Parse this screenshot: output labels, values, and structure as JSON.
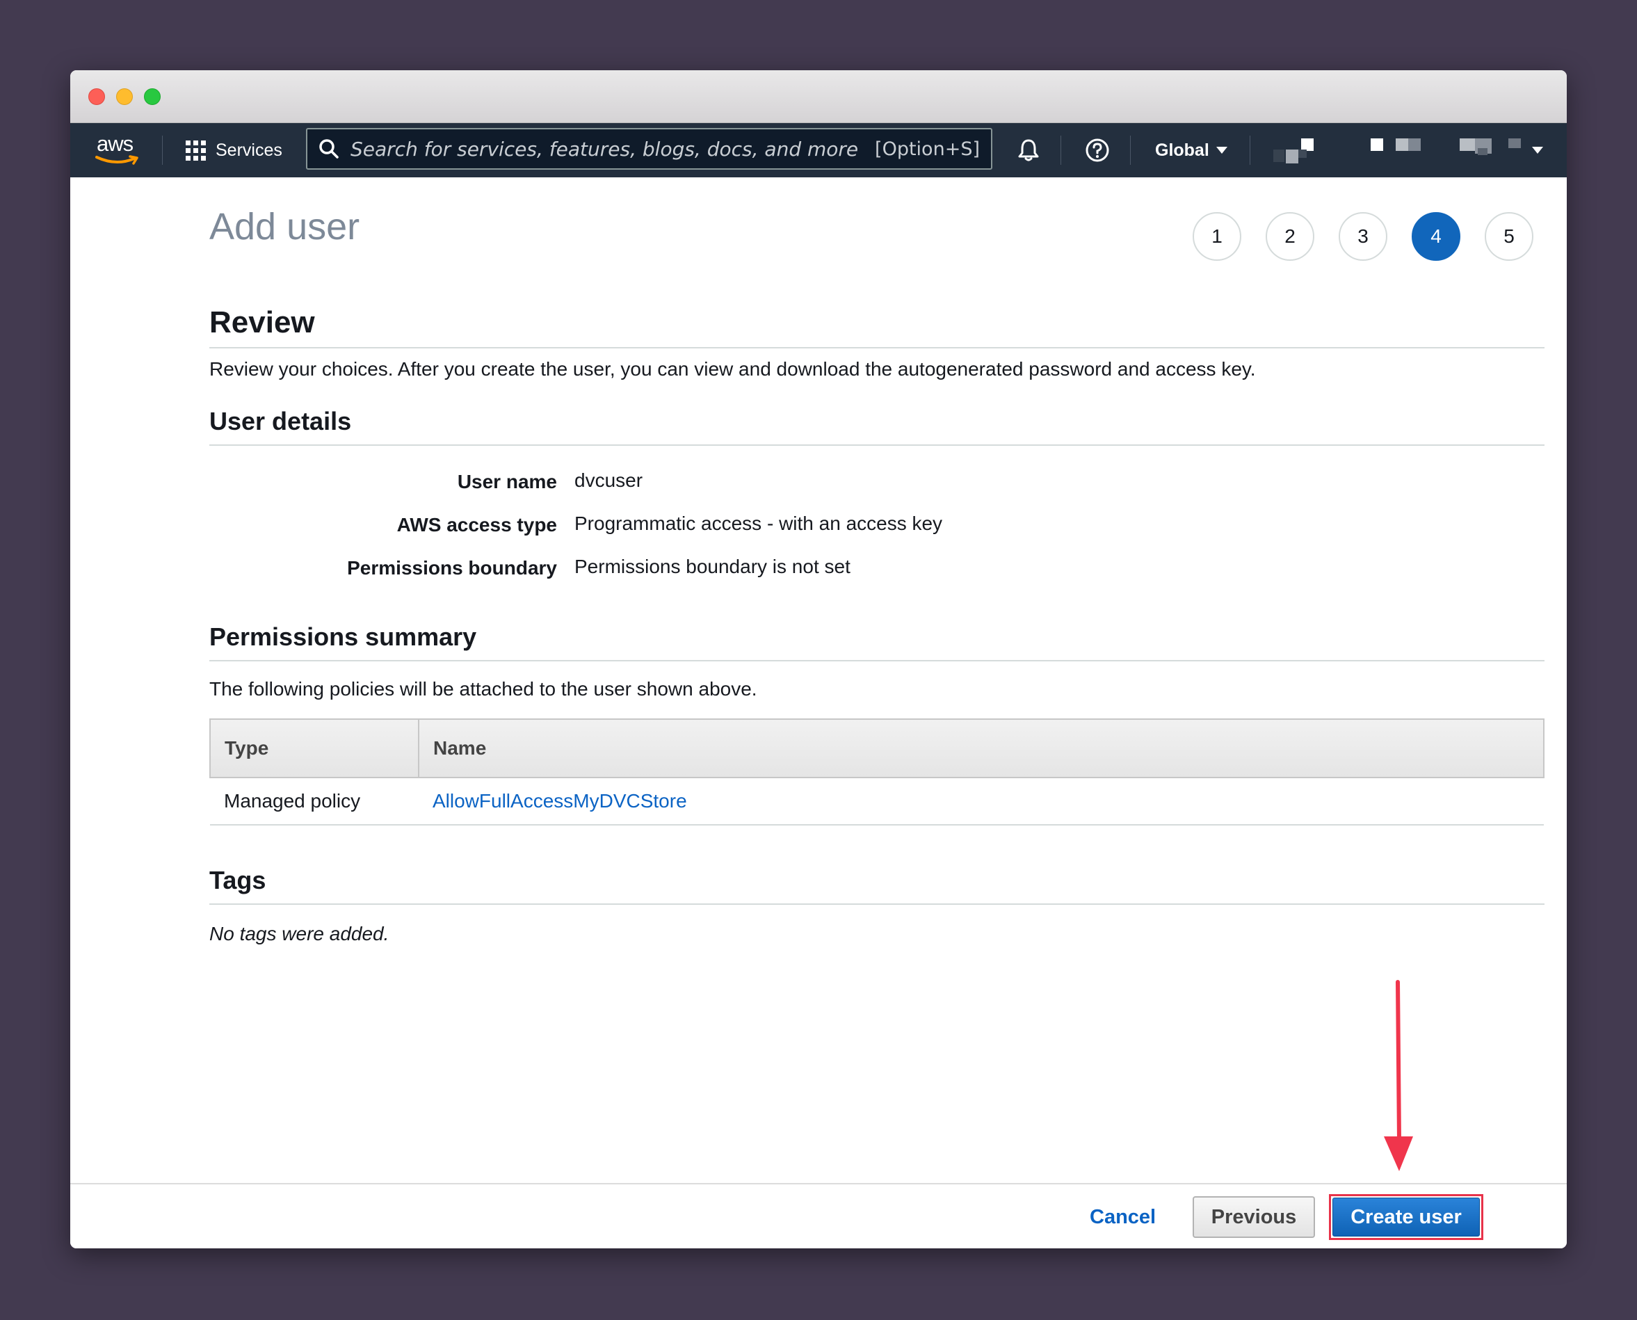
{
  "navbar": {
    "logo": "aws",
    "services_label": "Services",
    "search_placeholder": "Search for services, features, blogs, docs, and more",
    "search_shortcut": "[Option+S]",
    "region_label": "Global"
  },
  "page": {
    "title": "Add user",
    "steps": [
      "1",
      "2",
      "3",
      "4",
      "5"
    ],
    "active_step": 4
  },
  "review": {
    "heading": "Review",
    "description": "Review your choices. After you create the user, you can view and download the autogenerated password and access key."
  },
  "user_details": {
    "heading": "User details",
    "rows": [
      {
        "label": "User name",
        "value": "dvcuser"
      },
      {
        "label": "AWS access type",
        "value": "Programmatic access - with an access key"
      },
      {
        "label": "Permissions boundary",
        "value": "Permissions boundary is not set"
      }
    ]
  },
  "permissions": {
    "heading": "Permissions summary",
    "description": "The following policies will be attached to the user shown above.",
    "columns": [
      "Type",
      "Name"
    ],
    "rows": [
      {
        "type": "Managed policy",
        "name": "AllowFullAccessMyDVCStore"
      }
    ]
  },
  "tags": {
    "heading": "Tags",
    "note": "No tags were added."
  },
  "footer": {
    "cancel_label": "Cancel",
    "previous_label": "Previous",
    "create_label": "Create user"
  },
  "colors": {
    "navbar_bg": "#232f3e",
    "primary_blue": "#1166bb",
    "link_blue": "#0b63c4",
    "highlight_red": "#e8334a",
    "backdrop": "#433a50"
  }
}
